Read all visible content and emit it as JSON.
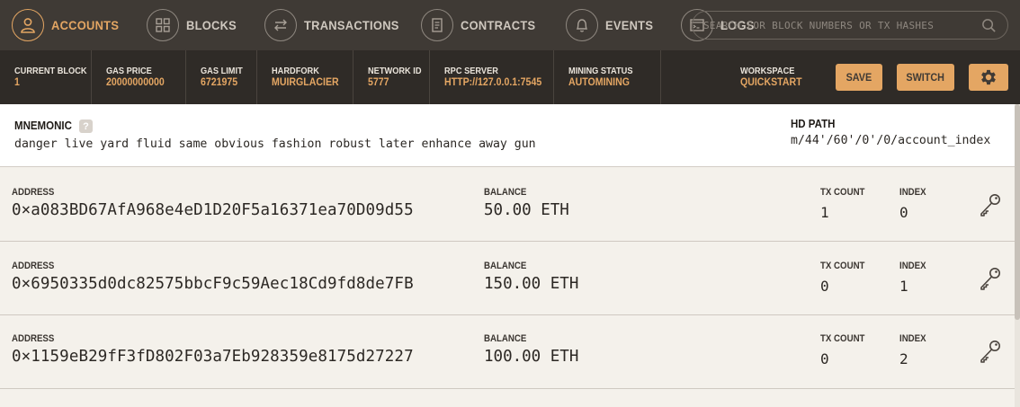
{
  "nav": {
    "items": [
      {
        "label": "ACCOUNTS",
        "icon": "person-icon",
        "active": true
      },
      {
        "label": "BLOCKS",
        "icon": "grid-icon"
      },
      {
        "label": "TRANSACTIONS",
        "icon": "swap-arrows-icon"
      },
      {
        "label": "CONTRACTS",
        "icon": "document-icon"
      },
      {
        "label": "EVENTS",
        "icon": "bell-icon"
      },
      {
        "label": "LOGS",
        "icon": "terminal-icon"
      }
    ],
    "search_placeholder": "SEARCH FOR BLOCK NUMBERS OR TX HASHES"
  },
  "status": {
    "current_block": {
      "label": "CURRENT BLOCK",
      "value": "1"
    },
    "gas_price": {
      "label": "GAS PRICE",
      "value": "20000000000"
    },
    "gas_limit": {
      "label": "GAS LIMIT",
      "value": "6721975"
    },
    "hardfork": {
      "label": "HARDFORK",
      "value": "MUIRGLACIER"
    },
    "network_id": {
      "label": "NETWORK ID",
      "value": "5777"
    },
    "rpc_server": {
      "label": "RPC SERVER",
      "value": "HTTP://127.0.0.1:7545"
    },
    "mining_status": {
      "label": "MINING STATUS",
      "value": "AUTOMINING"
    },
    "workspace": {
      "label": "WORKSPACE",
      "value": "QUICKSTART"
    },
    "save_label": "SAVE",
    "switch_label": "SWITCH"
  },
  "mnemonic": {
    "label": "MNEMONIC",
    "help": "?",
    "value": "danger live yard fluid same obvious fashion robust later enhance away gun",
    "hd_path_label": "HD PATH",
    "hd_path_value": "m/44'/60'/0'/0/account_index"
  },
  "account_labels": {
    "address": "ADDRESS",
    "balance": "BALANCE",
    "tx_count": "TX COUNT",
    "index": "INDEX"
  },
  "accounts": [
    {
      "address": "0×a083BD67AfA968e4eD1D20F5a16371ea70D09d55",
      "balance": "50.00 ETH",
      "tx_count": "1",
      "index": "0"
    },
    {
      "address": "0×6950335d0dc82575bbcF9c59Aec18Cd9fd8de7FB",
      "balance": "150.00 ETH",
      "tx_count": "0",
      "index": "1"
    },
    {
      "address": "0×1159eB29fF3fD802F03a7Eb928359e8175d27227",
      "balance": "100.00 ETH",
      "tx_count": "0",
      "index": "2"
    }
  ],
  "colors": {
    "accent": "#e4a663",
    "nav_bg": "#3f3a35",
    "status_bg": "#2f2b27",
    "content_bg": "#f4f1eb"
  }
}
